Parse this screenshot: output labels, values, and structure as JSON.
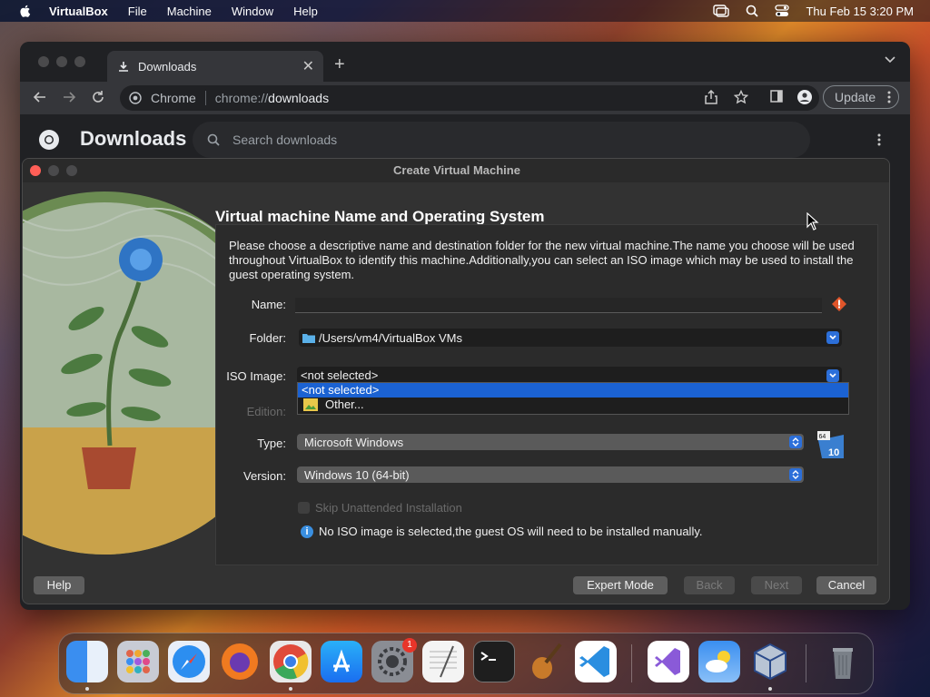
{
  "menubar": {
    "app": "VirtualBox",
    "items": [
      "File",
      "Machine",
      "Window",
      "Help"
    ],
    "datetime": "Thu Feb 15  3:20 PM"
  },
  "chrome": {
    "tab_title": "Downloads",
    "site_label": "Chrome",
    "url_scheme": "chrome://",
    "url_host": "downloads",
    "update_label": "Update",
    "page_title": "Downloads",
    "search_placeholder": "Search downloads"
  },
  "dialog": {
    "title": "Create Virtual Machine",
    "heading": "Virtual machine Name and Operating System",
    "description": "Please choose a descriptive name and destination folder for the new virtual machine.The name you choose will be used throughout VirtualBox to identify this machine.Additionally,you can select an ISO image which may be used to install the guest operating system.",
    "labels": {
      "name": "Name:",
      "folder": "Folder:",
      "iso": "ISO Image:",
      "edition": "Edition:",
      "type": "Type:",
      "version": "Version:"
    },
    "name_value": "",
    "folder_value": "/Users/vm4/VirtualBox VMs",
    "iso_value": "<not selected>",
    "iso_options": [
      "<not selected>",
      "Other..."
    ],
    "type_value": "Microsoft Windows",
    "version_value": "Windows 10 (64-bit)",
    "os_badge": {
      "bits": "64",
      "ver": "10"
    },
    "skip_unattended_label": "Skip Unattended Installation",
    "info_text": "No ISO image is selected,the guest OS will need to be installed manually.",
    "buttons": {
      "help": "Help",
      "expert": "Expert Mode",
      "back": "Back",
      "next": "Next",
      "cancel": "Cancel"
    }
  },
  "dock": {
    "items": [
      "Finder",
      "Launchpad",
      "Safari",
      "Firefox",
      "Chrome",
      "App Store",
      "System Settings",
      "TextEdit",
      "Terminal",
      "GarageBand",
      "Visual Studio Code",
      "Visual Studio",
      "Weather",
      "VirtualBox",
      "Trash"
    ],
    "settings_badge": "1"
  }
}
